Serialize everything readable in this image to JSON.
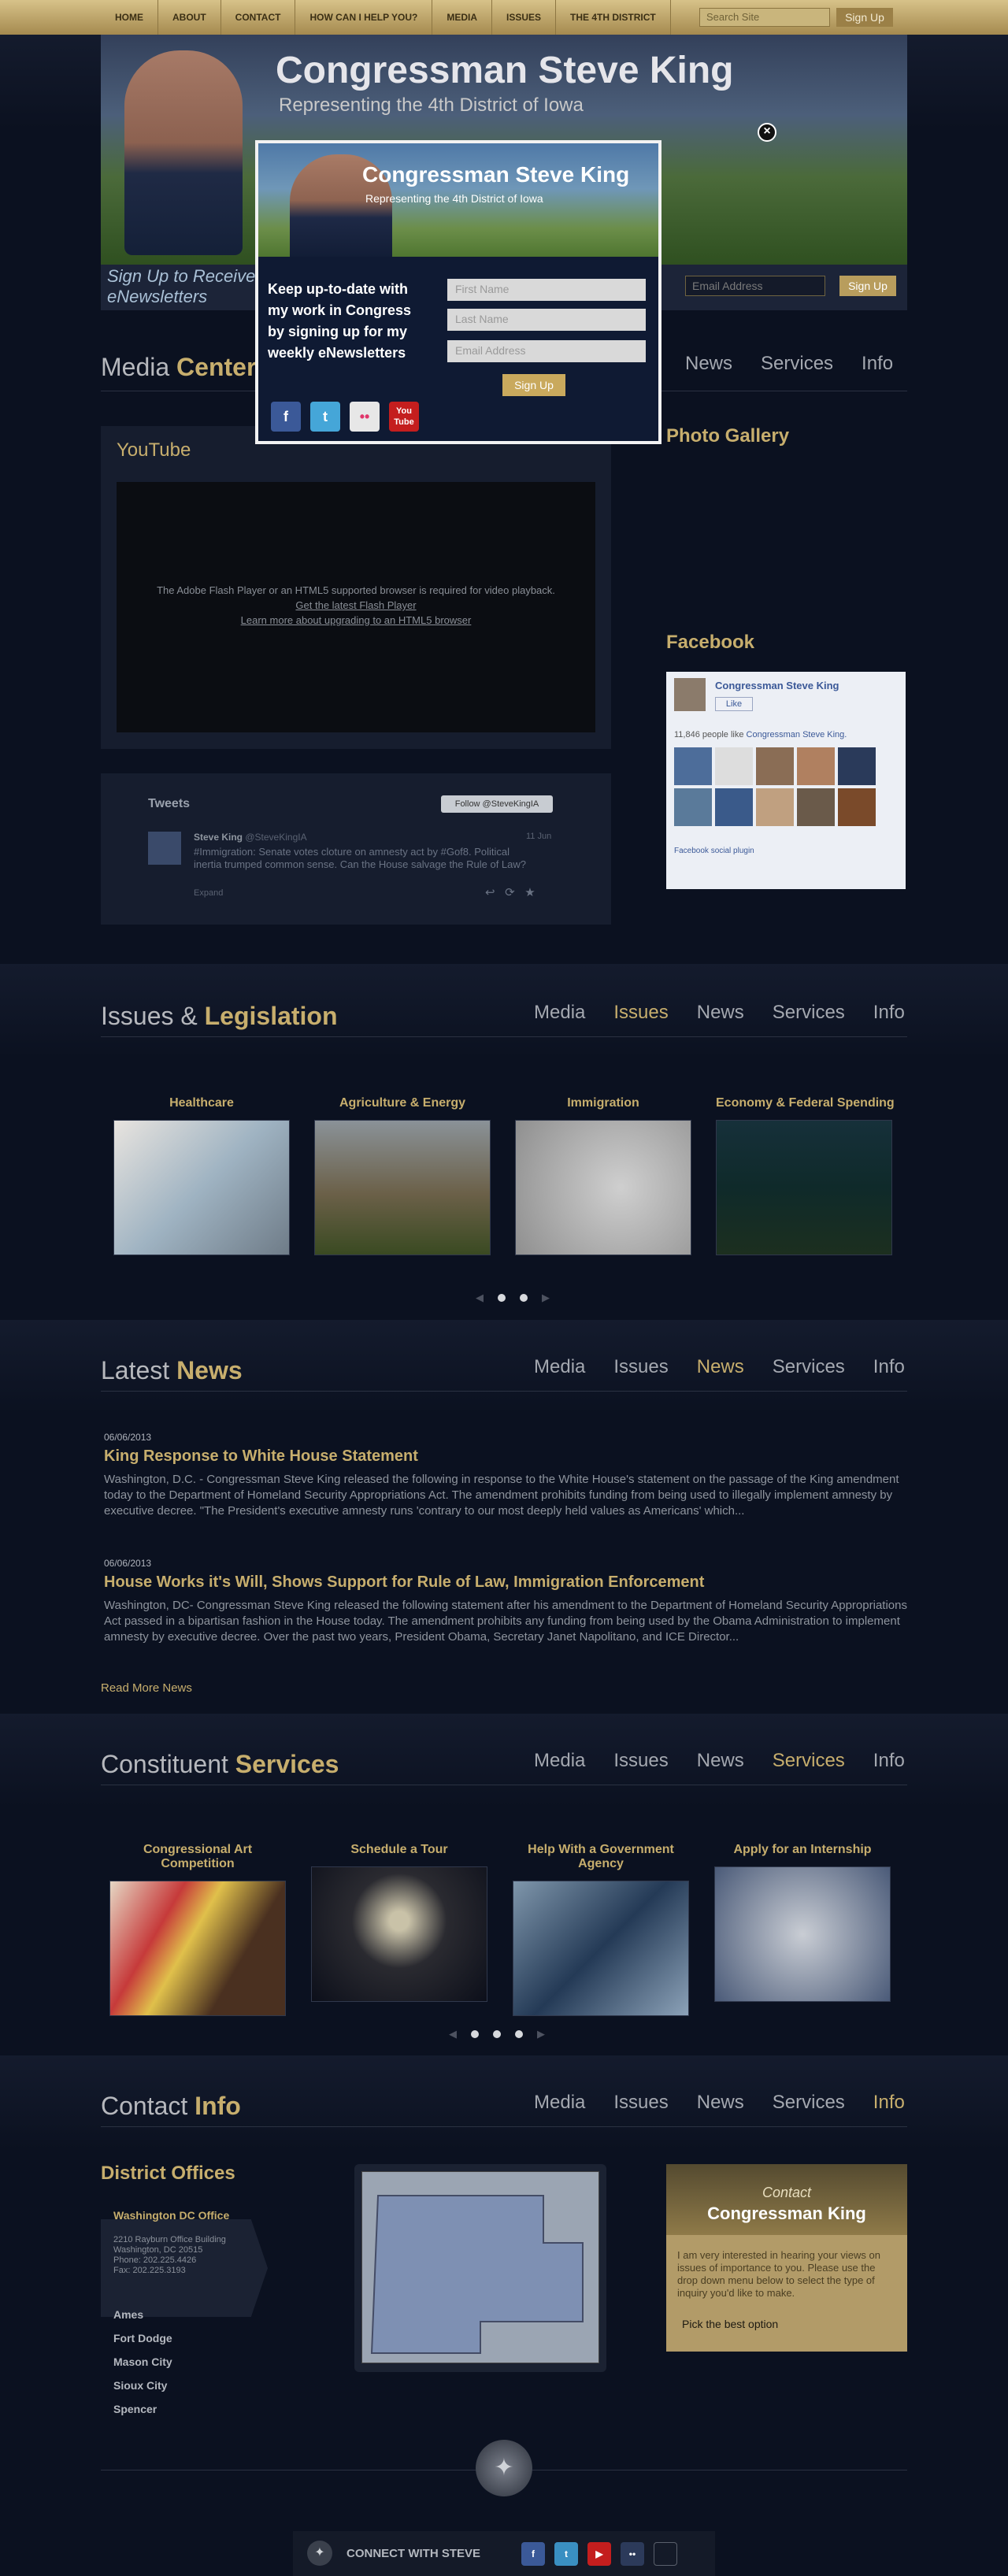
{
  "topnav": {
    "items": [
      "HOME",
      "ABOUT",
      "CONTACT",
      "HOW CAN I HELP YOU?",
      "MEDIA",
      "ISSUES",
      "THE 4TH DISTRICT"
    ],
    "search_placeholder": "Search Site",
    "search_button": "Sign Up"
  },
  "hero": {
    "title": "Congressman Steve King",
    "subtitle": "Representing the 4th District of Iowa"
  },
  "signup": {
    "line1": "Sign Up to Receive",
    "line2": "eNewsletters",
    "email_placeholder": "Email Address",
    "button": "Sign Up"
  },
  "modal": {
    "title": "Congressman Steve King",
    "subtitle": "Representing the 4th District of Iowa",
    "body": "Keep up-to-date with my work in Congress by signing up for my weekly eNewsletters",
    "first": "First Name",
    "last": "Last Name",
    "email": "Email Address",
    "button": "Sign Up",
    "close": "×",
    "social": [
      "f",
      "t",
      "••",
      "You Tube"
    ]
  },
  "sections": {
    "media": {
      "h1": "Media ",
      "h2": "Center",
      "nav": [
        "News",
        "Services",
        "Info"
      ]
    },
    "issues": {
      "h1": "Issues & ",
      "h2": "Legislation",
      "nav": [
        "Media",
        "Issues",
        "News",
        "Services",
        "Info"
      ]
    },
    "news": {
      "h1": "Latest ",
      "h2": "News",
      "nav": [
        "Media",
        "Issues",
        "News",
        "Services",
        "Info"
      ]
    },
    "services": {
      "h1": "Constituent ",
      "h2": "Services",
      "nav": [
        "Media",
        "Issues",
        "News",
        "Services",
        "Info"
      ]
    },
    "contact": {
      "h1": "Contact ",
      "h2": "Info",
      "nav": [
        "Media",
        "Issues",
        "News",
        "Services",
        "Info"
      ]
    }
  },
  "youtube": {
    "title": "YouTube",
    "msg": "The Adobe Flash Player or an HTML5 supported browser is required for video playback.",
    "link1": "Get the latest Flash Player",
    "link2": "Learn more about upgrading to an HTML5 browser"
  },
  "tweets": {
    "title": "Tweets",
    "follow": "Follow @SteveKingIA",
    "name": "Steve King",
    "handle": "@SteveKingIA",
    "date": "11 Jun",
    "text": "#Immigration: Senate votes cloture on amnesty act by #Gof8. Political inertia trumped common sense. Can the House salvage the Rule of Law?",
    "expand": "Expand"
  },
  "photo": {
    "title": "Photo Gallery"
  },
  "facebook": {
    "title": "Facebook",
    "page": "Congressman Steve King",
    "like": "Like",
    "count": "11,846 people like",
    "count_link": "Congressman Steve King.",
    "plugin": "Facebook social plugin"
  },
  "issues": [
    {
      "title": "Healthcare"
    },
    {
      "title": "Agriculture & Energy"
    },
    {
      "title": "Immigration"
    },
    {
      "title": "Economy & Federal Spending"
    }
  ],
  "news": {
    "items": [
      {
        "date": "06/06/2013",
        "title": "King Response to White House Statement",
        "body": "Washington, D.C. - Congressman Steve King released the following in response to the White House's statement on the passage of the King amendment today to the Department of Homeland Security Appropriations Act. The amendment prohibits funding from being used to illegally implement amnesty by executive decree. \"The President's executive amnesty runs 'contrary to our most deeply held values as Americans' which..."
      },
      {
        "date": "06/06/2013",
        "title": "House Works it's Will, Shows Support for Rule of Law, Immigration Enforcement",
        "body": "Washington, DC- Congressman Steve King released the following statement after his amendment to the Department of Homeland Security Appropriations Act passed in a bipartisan fashion in the House today. The amendment prohibits any funding from being used by the Obama Administration to implement amnesty by executive decree. Over the past two years, President Obama, Secretary Janet Napolitano, and ICE Director..."
      }
    ],
    "more": "Read More News"
  },
  "services": [
    {
      "title": "Congressional Art Competition"
    },
    {
      "title": "Schedule a Tour"
    },
    {
      "title": "Help With a Government Agency"
    },
    {
      "title": "Apply for an Internship"
    }
  ],
  "contact": {
    "district_title": "District Offices",
    "office": "Washington DC Office",
    "address": [
      "2210 Rayburn Office Building",
      "Washington, DC 20515",
      "Phone: 202.225.4426",
      "Fax: 202.225.3193"
    ],
    "cities": [
      "Ames",
      "Fort Dodge",
      "Mason City",
      "Sioux City",
      "Spencer"
    ],
    "box_small": "Contact",
    "box_title": "Congressman King",
    "box_body": "I am very interested in hearing your views on issues of importance to you. Please use the drop down menu below to select the type of inquiry you'd like to make.",
    "select": "Pick the best option"
  },
  "footer": {
    "connect": "CONNECT WITH STEVE"
  }
}
